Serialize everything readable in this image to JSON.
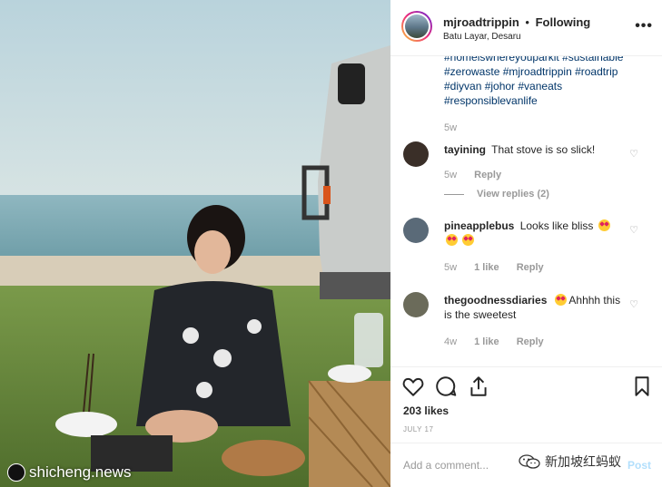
{
  "post": {
    "username": "mjroadtrippin",
    "separator": "•",
    "follow_status": "Following",
    "location": "Batu Layar, Desaru",
    "more_icon": "more-horizontal-icon"
  },
  "caption": {
    "hashtags_line1": "#homeiswhereyouparkit #sustainable",
    "hashtags_line2": "#zerowaste #mjroadtrippin #roadtrip",
    "hashtags_line3": "#diyvan #johor #vaneats",
    "hashtags_line4": "#responsiblevanlife",
    "time": "5w"
  },
  "comments": [
    {
      "username": "tayining",
      "text": "That stove is so slick!",
      "time": "5w",
      "reply_label": "Reply",
      "view_replies": "View replies (2)",
      "avatar_color": "#3a2f28"
    },
    {
      "username": "pineapplebus",
      "text": "Looks like bliss",
      "time": "5w",
      "likes": "1 like",
      "reply_label": "Reply",
      "avatar_color": "#5a6a78"
    },
    {
      "username": "thegoodnessdiaries",
      "text": "Ahhhh this is the sweetest",
      "time": "4w",
      "likes": "1 like",
      "reply_label": "Reply",
      "avatar_color": "#6b6b5a"
    }
  ],
  "actions": {
    "likes": "203 likes",
    "date": "JULY 17"
  },
  "add_comment": {
    "placeholder": "Add a comment...",
    "post_label": "Post"
  },
  "watermarks": {
    "left": "shicheng.news",
    "right": "新加坡红蚂蚁"
  },
  "colors": {
    "link": "#003569",
    "muted": "#999999",
    "text": "#262626",
    "post_button": "#b2dffc"
  }
}
